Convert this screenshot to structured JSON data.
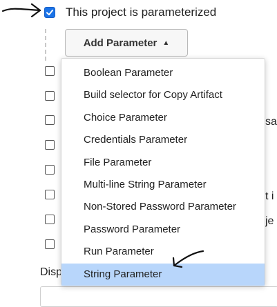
{
  "parameterized": {
    "label": "This project is parameterized",
    "checked": true
  },
  "add_button": {
    "label": "Add Parameter",
    "icon": "caret-up-icon"
  },
  "background": {
    "disp_fragment": "Disp",
    "fragment_sa": "sa",
    "fragment_t_i": "t i",
    "fragment_je": "je"
  },
  "menu": {
    "selected_index": 9,
    "selected_color": "#b8d6fb",
    "items": [
      "Boolean Parameter",
      "Build selector for Copy Artifact",
      "Choice Parameter",
      "Credentials Parameter",
      "File Parameter",
      "Multi-line String Parameter",
      "Non-Stored Password Parameter",
      "Password Parameter",
      "Run Parameter",
      "String Parameter"
    ]
  },
  "annotations": {
    "arrow_color": "#111111"
  },
  "accent_color": "#1a73e8"
}
